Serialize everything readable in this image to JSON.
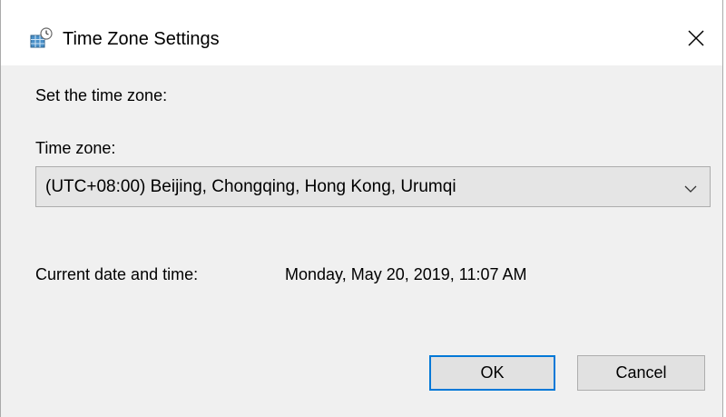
{
  "window": {
    "title": "Time Zone Settings",
    "title_icon": "clock-globe-icon",
    "close_glyph": "✕"
  },
  "dialog": {
    "set_label": "Set the time zone:",
    "timezone_label": "Time zone:",
    "timezone_selected": "(UTC+08:00) Beijing, Chongqing, Hong Kong, Urumqi",
    "current_label": "Current date and time:",
    "current_value": "Monday, May 20, 2019, 11:07 AM"
  },
  "buttons": {
    "ok": "OK",
    "cancel": "Cancel"
  },
  "colors": {
    "accent": "#0078d7",
    "dialog_bg": "#f0f0f0",
    "titlebar_bg": "#ffffff"
  }
}
